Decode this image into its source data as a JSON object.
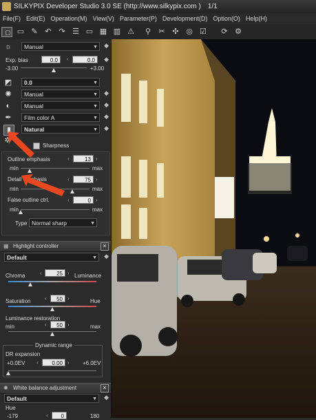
{
  "window": {
    "title": "SILKYPIX Developer Studio 3.0 SE  (http://www.silkypix.com )",
    "counter": "1/1"
  },
  "menu": [
    "File(F)",
    "Edit(E)",
    "Operation(M)",
    "View(V)",
    "Parameter(P)",
    "Development(D)",
    "Option(O)",
    "Help(H)"
  ],
  "toolbar": {
    "icons": [
      "open-icon",
      "folder-icon",
      "brush-icon",
      "undo-icon",
      "redo-icon",
      "list-view-icon",
      "single-view-icon",
      "compare-view-icon",
      "grid-icon",
      "film-icon",
      "warning-icon",
      "zoom-icon",
      "cut-icon",
      "develop-icon",
      "check-icon",
      "mark-icon",
      "rotate-icon",
      "settings-icon"
    ]
  },
  "panel": {
    "exposure": {
      "mode": "Manual",
      "label": "Exp. bias",
      "value_left": "0.0",
      "value_right": "0.0",
      "min": "-3.00",
      "max": "+3.00",
      "level": 0.5
    },
    "wb_value": "0.0",
    "rows": [
      {
        "value": "Manual"
      },
      {
        "value": "Manual"
      },
      {
        "value": "Film color A"
      },
      {
        "value": "Natural"
      }
    ],
    "sharpness": {
      "title": "Sharpness",
      "outline": {
        "label": "Outline emphasis",
        "value": "13",
        "min": "min",
        "max": "max",
        "level": 0.13
      },
      "detail": {
        "label": "Detail emphasis",
        "value": "75",
        "min": "min",
        "max": "max",
        "level": 0.75
      },
      "false_outline": {
        "label": "False outline ctrl.",
        "value": "0",
        "min": "min",
        "max": "max",
        "level": 0.0
      },
      "type_label": "Type",
      "type_value": "Normal sharp"
    },
    "highlight": {
      "title": "Highlight controller",
      "preset": "Default",
      "chroma_label": "Chroma",
      "chroma_value": "25",
      "luminance_label": "Luminance",
      "chroma_level": 0.25,
      "saturation_label": "Saturation",
      "saturation_value": "50",
      "hue_label": "Hue",
      "saturation_level": 0.5,
      "lumrest_label": "Luminance restoration",
      "lumrest_value": "50",
      "min": "min",
      "max": "max",
      "lumrest_level": 0.5,
      "dr_title": "Dynamic range",
      "dr_label": "DR expansion",
      "dr_min": "+0.0EV",
      "dr_value": "0.00",
      "dr_max": "+6.0EV",
      "dr_level": 0.0
    },
    "wb": {
      "title": "White balance adjustment",
      "preset": "Default",
      "hue_label": "Hue",
      "hue_min": "-179",
      "hue_value": "0",
      "hue_max": "180"
    }
  },
  "photo": {
    "description_free": true
  }
}
